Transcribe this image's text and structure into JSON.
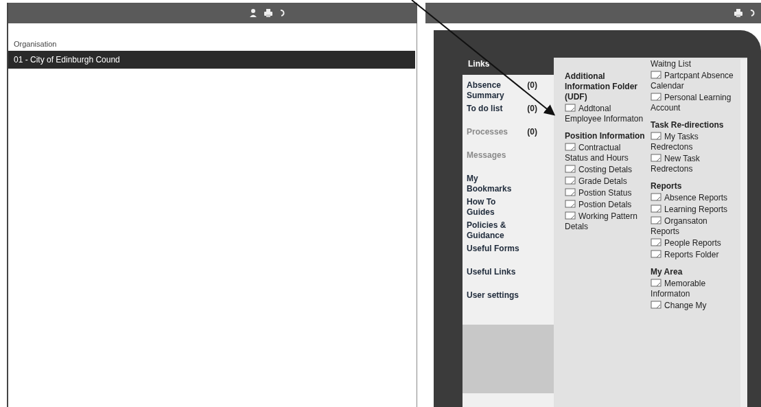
{
  "left_panel": {
    "field_label": "Organisation",
    "rows": [
      {
        "text": "01 - City of Edinburgh Cound",
        "selected": true
      }
    ]
  },
  "right_panel": {
    "links_title": "Links",
    "menu": [
      {
        "label": "Absence Summary",
        "count": "(0)",
        "disabled": false
      },
      {
        "label": "To do list",
        "count": "(0)",
        "disabled": false
      },
      {
        "label": "Processes",
        "count": "(0)",
        "disabled": true
      },
      {
        "label": "Messages",
        "disabled": true
      },
      {
        "label": "My Bookmarks",
        "disabled": false
      },
      {
        "label": "How To Guides",
        "disabled": false
      },
      {
        "label": "Policies & Guidance",
        "disabled": false
      },
      {
        "label": "Useful Forms",
        "disabled": false
      },
      {
        "label": "Useful Links",
        "disabled": false
      },
      {
        "label": "User settings",
        "disabled": false
      }
    ],
    "columns": [
      [
        {
          "kind": "heading",
          "text": "Additional Information Folder (UDF)"
        },
        {
          "kind": "link",
          "text": "Addtonal Employee Informaton"
        },
        {
          "kind": "heading",
          "text": "Position Information"
        },
        {
          "kind": "link",
          "text": "Contractual Status and Hours"
        },
        {
          "kind": "link",
          "text": "Costing Detals"
        },
        {
          "kind": "link",
          "text": "Grade Detals"
        },
        {
          "kind": "link",
          "text": "Postion Status"
        },
        {
          "kind": "link",
          "text": "Postion Detals"
        },
        {
          "kind": "link",
          "text": "Working Pattern Detals"
        }
      ],
      [
        {
          "kind": "plain",
          "text": "Waitng List"
        },
        {
          "kind": "link",
          "text": "Partcpant Absence Calendar"
        },
        {
          "kind": "link",
          "text": "Personal Learning Account"
        },
        {
          "kind": "heading",
          "text": "Task Re-directions"
        },
        {
          "kind": "link",
          "text": "My Tasks Redrectons"
        },
        {
          "kind": "link",
          "text": "New Task Redrectons"
        },
        {
          "kind": "heading",
          "text": "Reports"
        },
        {
          "kind": "link",
          "text": "Absence Reports"
        },
        {
          "kind": "link",
          "text": "Learning Reports"
        },
        {
          "kind": "link",
          "text": "Organsaton Reports"
        },
        {
          "kind": "link",
          "text": "People Reports"
        },
        {
          "kind": "link",
          "text": "Reports Folder"
        },
        {
          "kind": "heading",
          "text": "My Area"
        },
        {
          "kind": "link",
          "text": "Memorable Informaton"
        },
        {
          "kind": "link",
          "text": "Change My"
        }
      ]
    ]
  }
}
